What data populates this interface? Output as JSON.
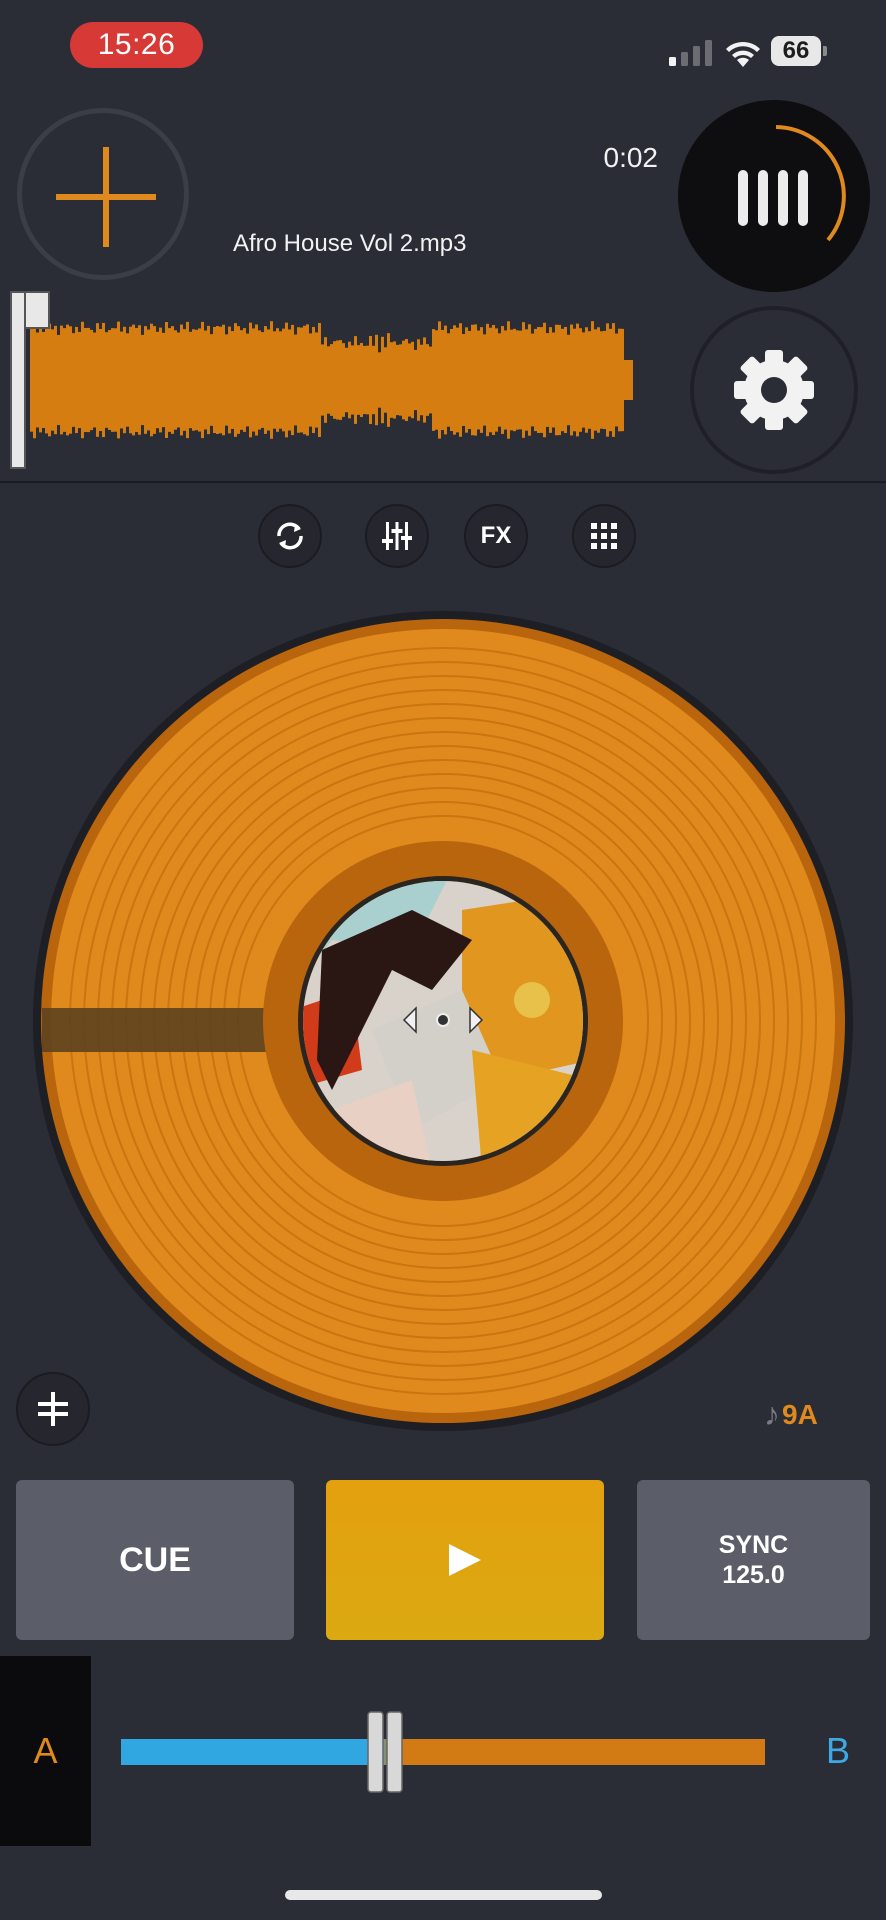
{
  "status_bar": {
    "time": "15:26",
    "battery": "66"
  },
  "deck": {
    "track_time": "0:02",
    "track_name": "Afro House Vol 2.mp3",
    "key": "9A"
  },
  "tools": [
    {
      "id": "loop",
      "icon": "loop-icon"
    },
    {
      "id": "eq",
      "icon": "eq-sliders-icon"
    },
    {
      "id": "fx",
      "label": "FX"
    },
    {
      "id": "pads",
      "icon": "grid-icon"
    }
  ],
  "transport": {
    "cue_label": "CUE",
    "play_icon": "play-icon",
    "sync_label": "SYNC",
    "bpm": "125.0"
  },
  "crossfader": {
    "left_label": "A",
    "right_label": "B",
    "position": 0.41
  },
  "playhead_progress": 0.02,
  "colors": {
    "accent": "#e08a1e",
    "deck_b": "#3fa9e6",
    "background": "#2a2c36",
    "record_time": "#d73a36"
  }
}
